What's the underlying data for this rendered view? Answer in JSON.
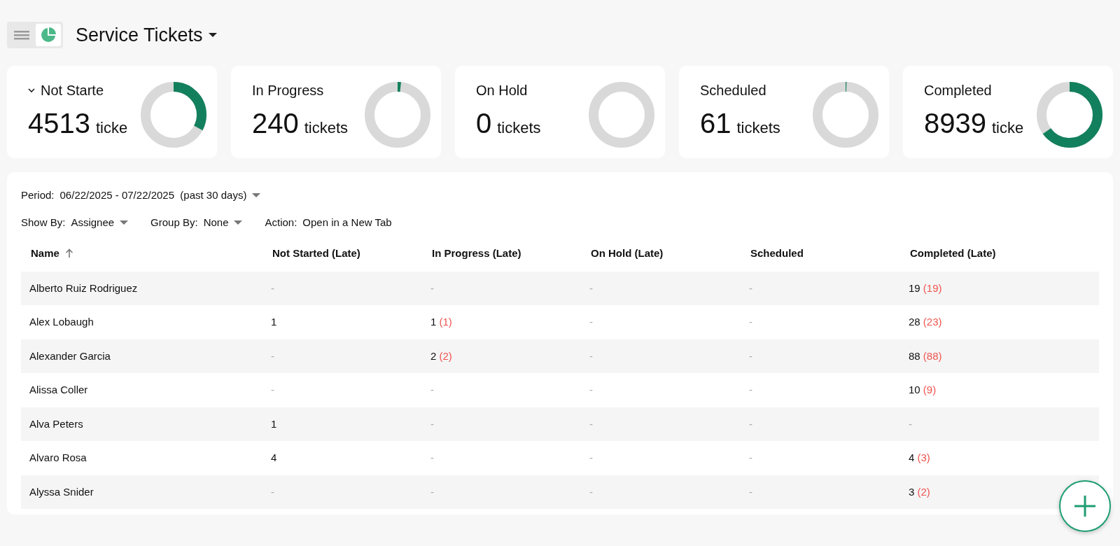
{
  "header": {
    "title": "Service Tickets"
  },
  "status_cards": [
    {
      "label": "Not Starte",
      "collapsible": true,
      "count": "4513",
      "unit": "ticke",
      "level": 0.328
    },
    {
      "label": "In Progress",
      "collapsible": false,
      "count": "240",
      "unit": "tickets",
      "level": 0.017
    },
    {
      "label": "On Hold",
      "collapsible": false,
      "count": "0",
      "unit": "tickets",
      "level": 0
    },
    {
      "label": "Scheduled",
      "collapsible": false,
      "count": "61",
      "unit": "tickets",
      "level": 0.004
    },
    {
      "label": "Completed",
      "collapsible": false,
      "count": "8939",
      "unit": "ticke",
      "level": 0.65
    }
  ],
  "filters": {
    "period": {
      "label": "Period:",
      "value": "06/22/2025 - 07/22/2025",
      "note": "(past 30 days)"
    },
    "options": [
      {
        "label": "Show By:",
        "value": "Assignee",
        "dropdown": true
      },
      {
        "label": "Group By:",
        "value": "None",
        "dropdown": true
      },
      {
        "label": "Action:",
        "value": "Open in a New Tab",
        "dropdown": false
      }
    ]
  },
  "table": {
    "columns": [
      {
        "label": "Name",
        "sorted": true
      },
      {
        "label": "Not Started (Late)",
        "sorted": false
      },
      {
        "label": "In Progress (Late)",
        "sorted": false
      },
      {
        "label": "On Hold (Late)",
        "sorted": false
      },
      {
        "label": "Scheduled",
        "sorted": false
      },
      {
        "label": "Completed (Late)",
        "sorted": false
      }
    ],
    "rows": [
      {
        "cells": [
          {
            "value": "Alberto Ruiz Rodriguez"
          },
          {
            "value": "-"
          },
          {
            "value": "-"
          },
          {
            "value": "-"
          },
          {
            "value": "-"
          },
          {
            "value": "19",
            "late": "(19)"
          }
        ]
      },
      {
        "cells": [
          {
            "value": "Alex Lobaugh"
          },
          {
            "value": "1"
          },
          {
            "value": "1",
            "late": "(1)"
          },
          {
            "value": "-"
          },
          {
            "value": "-"
          },
          {
            "value": "28",
            "late": "(23)"
          }
        ]
      },
      {
        "cells": [
          {
            "value": "Alexander Garcia"
          },
          {
            "value": "-"
          },
          {
            "value": "2",
            "late": "(2)"
          },
          {
            "value": "-"
          },
          {
            "value": "-"
          },
          {
            "value": "88",
            "late": "(88)"
          }
        ]
      },
      {
        "cells": [
          {
            "value": "Alissa Coller"
          },
          {
            "value": "-"
          },
          {
            "value": "-"
          },
          {
            "value": "-"
          },
          {
            "value": "-"
          },
          {
            "value": "10",
            "late": "(9)"
          }
        ]
      },
      {
        "cells": [
          {
            "value": "Alva Peters"
          },
          {
            "value": "1"
          },
          {
            "value": "-"
          },
          {
            "value": "-"
          },
          {
            "value": "-"
          },
          {
            "value": "-"
          }
        ]
      },
      {
        "cells": [
          {
            "value": "Alvaro Rosa"
          },
          {
            "value": "4"
          },
          {
            "value": "-"
          },
          {
            "value": "-"
          },
          {
            "value": "-"
          },
          {
            "value": "4",
            "late": "(3)"
          }
        ]
      },
      {
        "cells": [
          {
            "value": "Alyssa Snider"
          },
          {
            "value": "-"
          },
          {
            "value": "-"
          },
          {
            "value": "-"
          },
          {
            "value": "-"
          },
          {
            "value": "3",
            "late": "(2)"
          }
        ]
      }
    ]
  }
}
